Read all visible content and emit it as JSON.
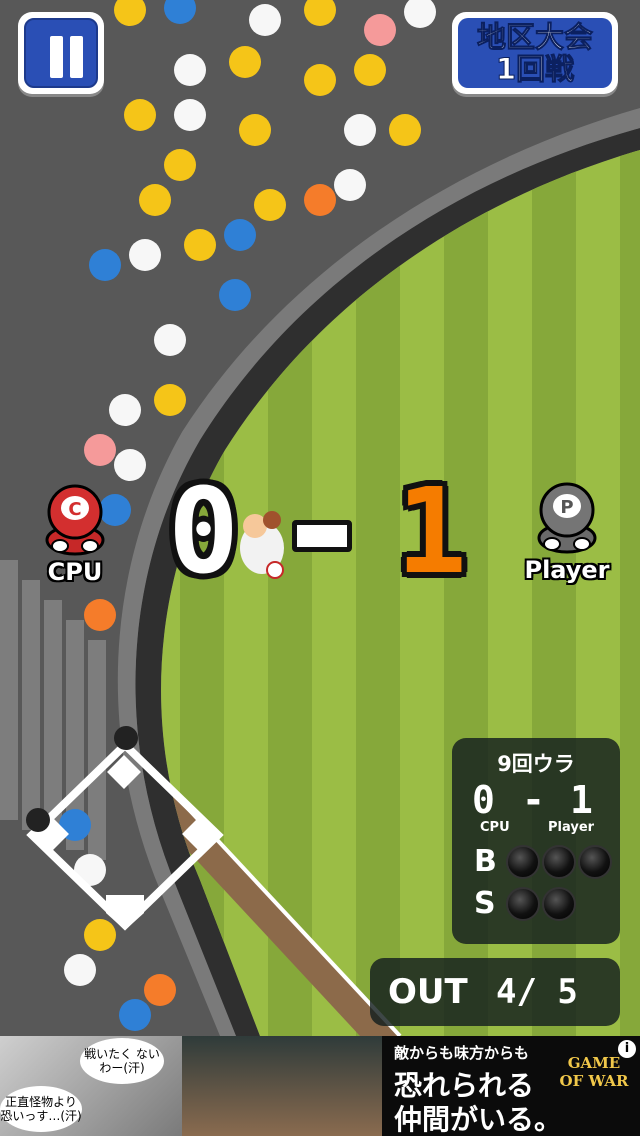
{
  "hud": {
    "pause_button_label": "",
    "stage_line1": "地区大会",
    "stage_line2": "1回戦"
  },
  "score": {
    "cpu_label": "CPU",
    "cpu_badge": "C",
    "cpu_score": "0",
    "dash": "-",
    "player_label": "Player",
    "player_badge": "P",
    "player_score": "1"
  },
  "scoreboard": {
    "inning": "9回ウラ",
    "cpu_score": "0",
    "dash": "-",
    "player_score": "1",
    "cpu_label": "CPU",
    "player_label": "Player",
    "ball_label": "B",
    "strike_label": "S",
    "balls_lit": 0,
    "strikes_lit": 0
  },
  "outs": {
    "label": "OUT",
    "value": "4/ 5"
  },
  "ad": {
    "bubble1": "戦いたく ないわー(汗)",
    "bubble2": "正直怪物より 恐いっす…(汗)",
    "copy_line1": "敵からも味方からも",
    "copy_line2": "恐れられる",
    "copy_line3": "仲間がいる。",
    "brand": "GAME OF WAR",
    "info_icon": "i"
  },
  "colors": {
    "field_light": "#9bbd45",
    "field_dark": "#86a83a",
    "stands": "#575757",
    "badge_blue": "#2a4fb5",
    "player_score": "#f57c00"
  }
}
